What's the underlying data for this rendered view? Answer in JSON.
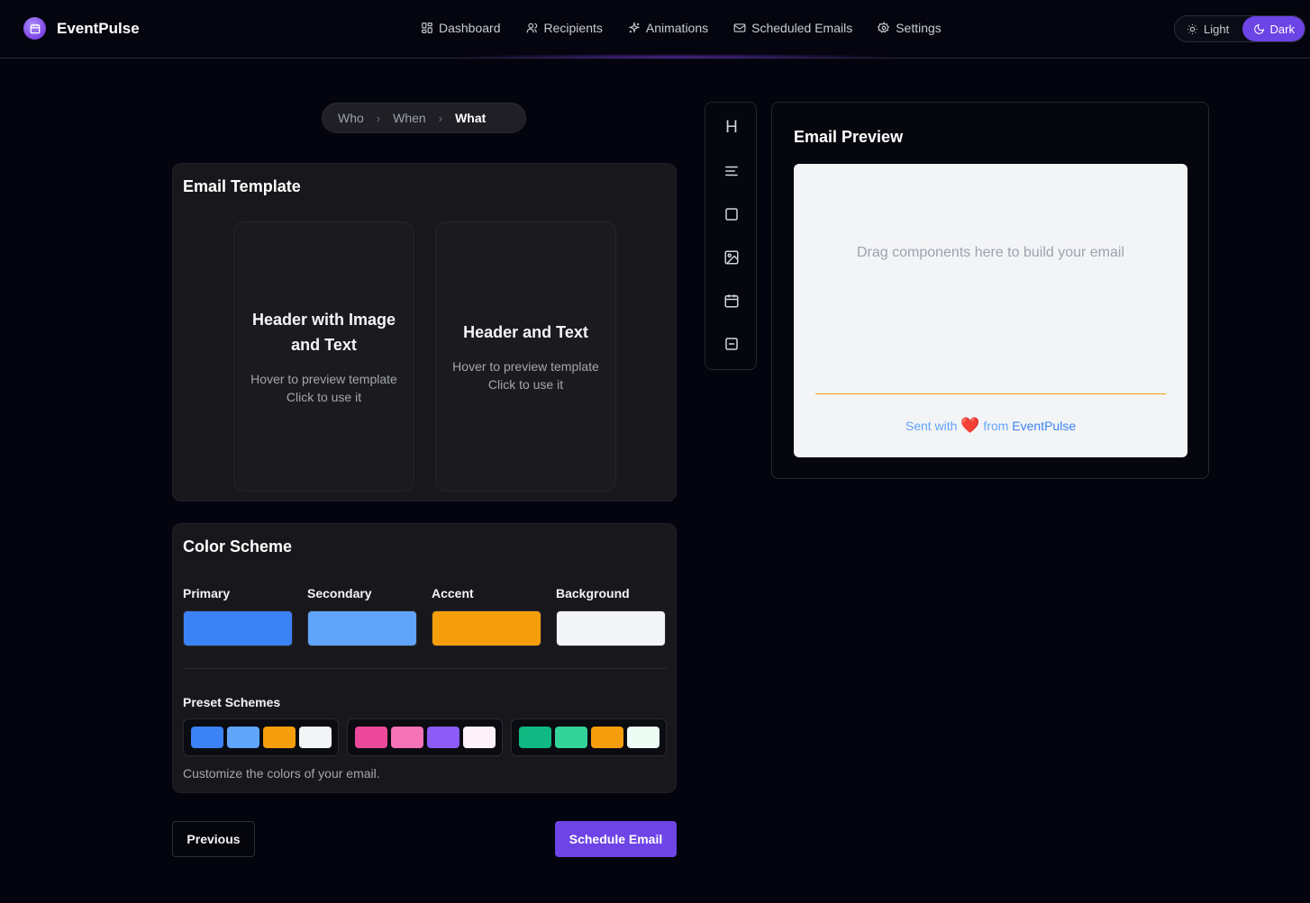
{
  "brand": {
    "name": "EventPulse",
    "icon": "calendar-icon"
  },
  "nav": [
    {
      "label": "Dashboard",
      "icon": "dashboard-icon"
    },
    {
      "label": "Recipients",
      "icon": "users-icon"
    },
    {
      "label": "Animations",
      "icon": "sparkles-icon"
    },
    {
      "label": "Scheduled Emails",
      "icon": "mail-icon"
    },
    {
      "label": "Settings",
      "icon": "gear-icon"
    }
  ],
  "theme": {
    "light": "Light",
    "dark": "Dark",
    "selected": "Dark"
  },
  "stepper": {
    "steps": [
      "Who",
      "When",
      "What"
    ],
    "active": "What"
  },
  "template_section": {
    "title": "Email Template",
    "templates": [
      {
        "title": "Header with Image and Text",
        "hint1": "Hover to preview template",
        "hint2": "Click to use it"
      },
      {
        "title": "Header and Text",
        "hint1": "Hover to preview template",
        "hint2": "Click to use it"
      }
    ]
  },
  "color_scheme": {
    "title": "Color Scheme",
    "colors": [
      {
        "label": "Primary",
        "value": "#3b82f6"
      },
      {
        "label": "Secondary",
        "value": "#60a5fa"
      },
      {
        "label": "Accent",
        "value": "#f59e0b"
      },
      {
        "label": "Background",
        "value": "#f3f4f6"
      }
    ],
    "preset_label": "Preset Schemes",
    "presets": [
      [
        "#3b82f6",
        "#60a5fa",
        "#f59e0b",
        "#f3f4f6"
      ],
      [
        "#ec4899",
        "#f472b6",
        "#8b5cf6",
        "#fdf2f8"
      ],
      [
        "#10b981",
        "#34d399",
        "#f59e0b",
        "#ecfdf5"
      ]
    ],
    "helper": "Customize the colors of your email."
  },
  "actions": {
    "previous": "Previous",
    "schedule": "Schedule Email"
  },
  "toolbar": {
    "tools": [
      {
        "name": "heading",
        "glyph": "H"
      },
      {
        "name": "text",
        "icon": "align-left-icon"
      },
      {
        "name": "button",
        "icon": "square-icon"
      },
      {
        "name": "image",
        "icon": "image-icon"
      },
      {
        "name": "event",
        "icon": "calendar-icon"
      },
      {
        "name": "divider",
        "icon": "minus-square-icon"
      }
    ]
  },
  "preview": {
    "title": "Email Preview",
    "drop_hint": "Drag components here to build your email",
    "footer_prefix": "Sent with",
    "footer_heart": "❤️",
    "footer_mid": "from",
    "footer_brand": "EventPulse"
  }
}
